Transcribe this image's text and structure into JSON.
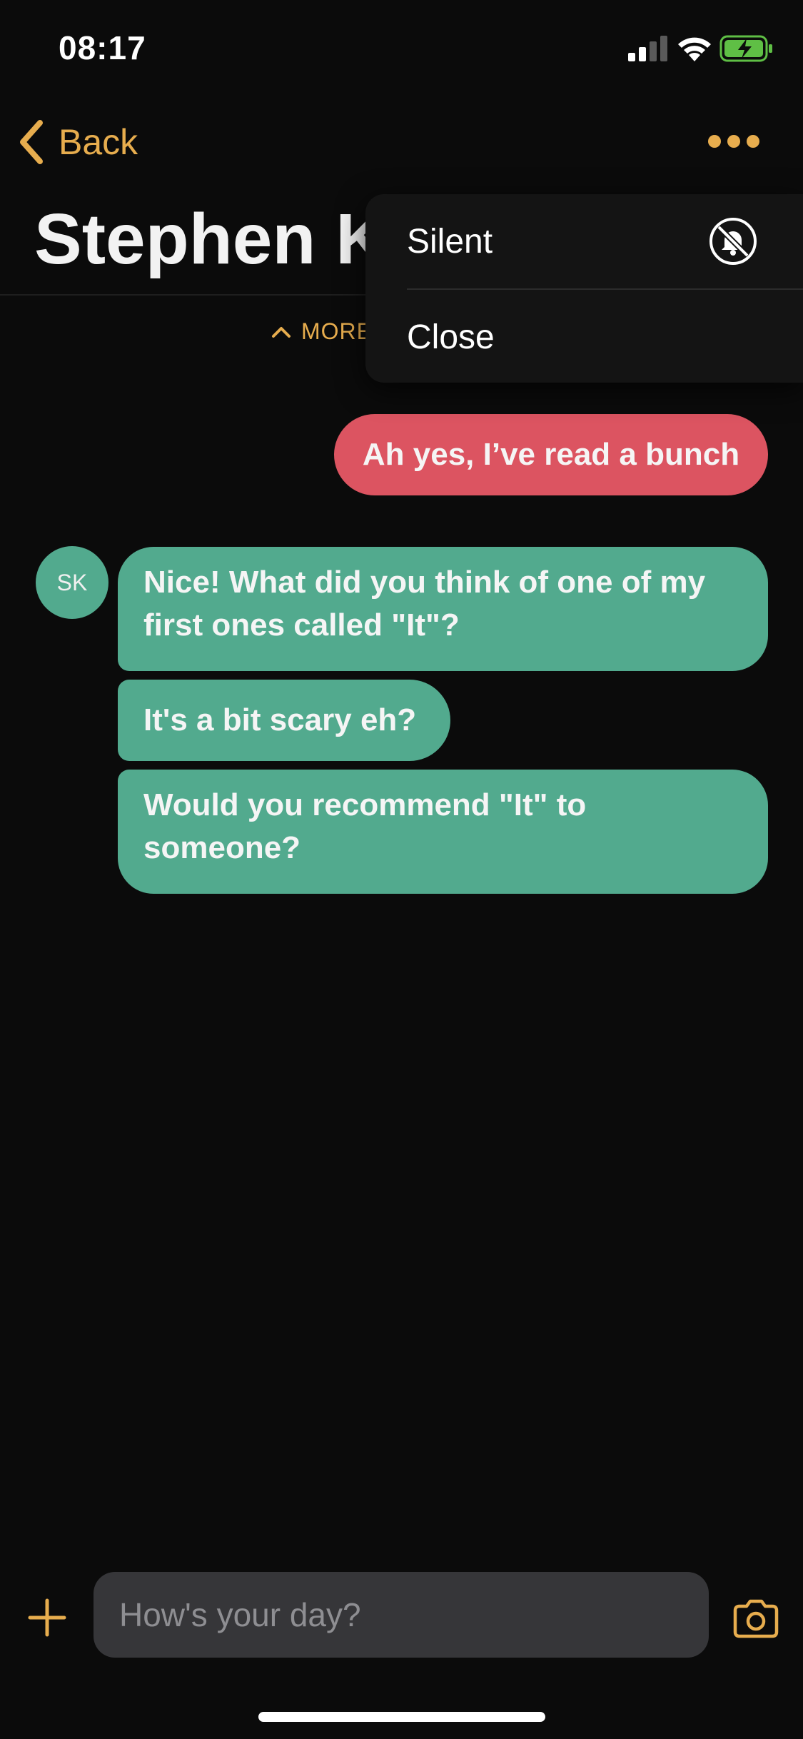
{
  "status_bar": {
    "time": "08:17"
  },
  "nav": {
    "back_label": "Back"
  },
  "contact": {
    "name": "Stephen K",
    "initials": "SK"
  },
  "more_toggle": {
    "label": "MORE"
  },
  "popup_menu": {
    "items": [
      {
        "label": "Silent",
        "icon": "bell-slash-icon"
      },
      {
        "label": "Close"
      }
    ]
  },
  "messages": [
    {
      "direction": "outgoing",
      "text": "Ah yes, I’ve read a bunch"
    },
    {
      "direction": "incoming",
      "text": "Nice! What did you think of one of my first ones called \"It\"?"
    },
    {
      "direction": "incoming",
      "text": "It's a bit scary eh?"
    },
    {
      "direction": "incoming",
      "text": "Would you recommend \"It\" to someone?"
    }
  ],
  "composer": {
    "placeholder": "How's your day?"
  },
  "colors": {
    "accent": "#e7ad4e",
    "outgoing_bubble": "#dc5461",
    "incoming_bubble": "#52aa8e",
    "background": "#0b0b0b",
    "input_background": "#363639"
  }
}
